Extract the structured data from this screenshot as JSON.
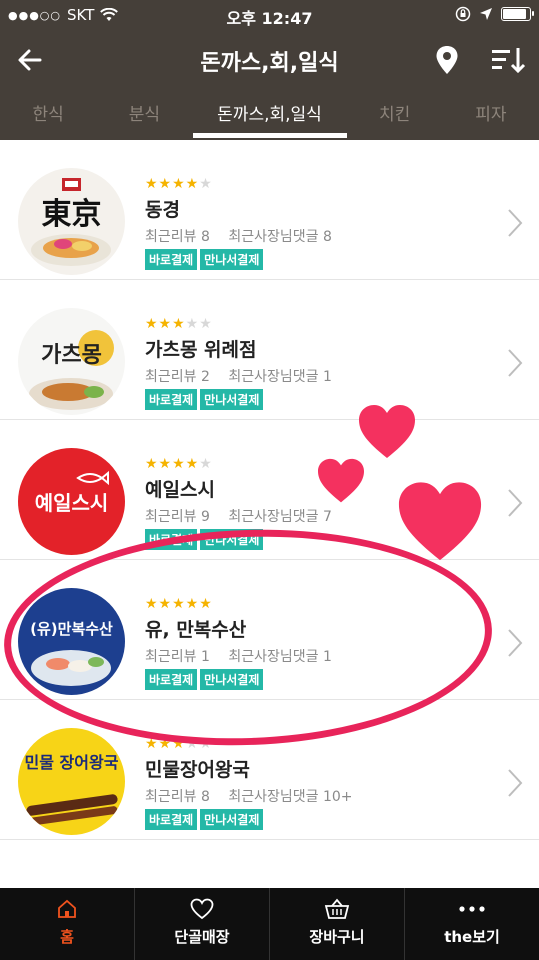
{
  "status_bar": {
    "carrier": "SKT",
    "signal_dots": "●●●○○",
    "time": "오후 12:47",
    "battery_level": 0.9
  },
  "header": {
    "title": "돈까스,회,일식"
  },
  "tabs": [
    {
      "label": "한식",
      "active": false
    },
    {
      "label": "분식",
      "active": false
    },
    {
      "label": "돈까스,회,일식",
      "active": true
    },
    {
      "label": "치킨",
      "active": false
    },
    {
      "label": "피자",
      "active": false
    }
  ],
  "restaurants": [
    {
      "logo_text": "東京",
      "rating_stars": 4.5,
      "stars_display": "★★★★★",
      "name": "동경",
      "recent_reviews": "최근리뷰 8",
      "owner_replies": "최근사장님댓글 8",
      "badges": [
        "바로결제",
        "만나서결제"
      ]
    },
    {
      "logo_text": "가츠몽",
      "rating_stars": 3.5,
      "stars_display": "★★★★★",
      "name": "가츠몽 위례점",
      "recent_reviews": "최근리뷰 2",
      "owner_replies": "최근사장님댓글 1",
      "badges": [
        "바로결제",
        "만나서결제"
      ]
    },
    {
      "logo_text": "예일스시",
      "rating_stars": 4.5,
      "stars_display": "★★★★★",
      "name": "예일스시",
      "recent_reviews": "최근리뷰 9",
      "owner_replies": "최근사장님댓글 7",
      "badges": [
        "바로결제",
        "만나서결제"
      ]
    },
    {
      "logo_text": "(유)만복수산",
      "rating_stars": 5,
      "stars_display": "★★★★★",
      "name": "유, 만복수산",
      "recent_reviews": "최근리뷰 1",
      "owner_replies": "최근사장님댓글 1",
      "badges": [
        "바로결제",
        "만나서결제"
      ]
    },
    {
      "logo_text": "민물 장어왕국",
      "rating_stars": 3.5,
      "stars_display": "★★★★★",
      "name": "민물장어왕국",
      "recent_reviews": "최근리뷰 8",
      "owner_replies": "최근사장님댓글 10+",
      "badges": [
        "바로결제",
        "만나서결제"
      ]
    }
  ],
  "bottom_nav": [
    {
      "label": "홈",
      "icon": "home-icon",
      "active": true
    },
    {
      "label": "단골매장",
      "icon": "heart-icon",
      "active": false
    },
    {
      "label": "장바구니",
      "icon": "basket-icon",
      "active": false
    },
    {
      "label": "the보기",
      "icon": "more-icon",
      "active": false
    }
  ],
  "colors": {
    "header_bg": "#453f39",
    "badge": "#24b8a7",
    "star": "#f5b300",
    "highlight": "#e8245a",
    "nav_active": "#f0531e"
  }
}
